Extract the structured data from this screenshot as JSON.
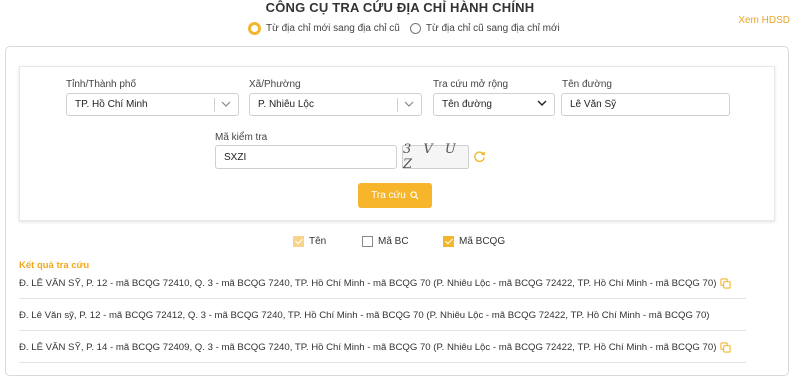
{
  "header": {
    "title": "CÔNG CỤ TRA CỨU ĐỊA CHỈ HÀNH CHÍNH",
    "help_link": "Xem HDSD"
  },
  "mode_options": [
    {
      "label": "Từ địa chỉ mới sang địa chỉ cũ",
      "selected": true
    },
    {
      "label": "Từ địa chỉ cũ sang địa chỉ mới",
      "selected": false
    }
  ],
  "form": {
    "province_label": "Tỉnh/Thành phố",
    "province_value": "TP. Hồ Chí Minh",
    "ward_label": "Xã/Phường",
    "ward_value": "P. Nhiêu Lộc",
    "extended_label": "Tra cứu mở rộng",
    "extended_value": "Tên đường",
    "street_label": "Tên đường",
    "street_value": "Lê Văn Sỹ",
    "captcha_label": "Mã kiểm tra",
    "captcha_input": "SXZI",
    "captcha_image_text": "3 V U Z",
    "search_button": "Tra cứu"
  },
  "display_options": [
    {
      "label": "Tên",
      "checked": true
    },
    {
      "label": "Mã BC",
      "checked": false
    },
    {
      "label": "Mã BCQG",
      "checked": true
    }
  ],
  "results": {
    "title": "Kết quả tra cứu",
    "rows": [
      "Đ. LÊ VĂN SỸ, P. 12 - mã BCQG 72410, Q. 3 - mã BCQG 7240, TP. Hồ Chí Minh - mã BCQG 70 (P. Nhiêu Lộc - mã BCQG 72422, TP. Hồ Chí Minh - mã BCQG 70)",
      "Đ. Lê Văn sỹ, P. 12 - mã BCQG 72412, Q. 3 - mã BCQG 7240, TP. Hồ Chí Minh - mã BCQG 70 (P. Nhiêu Lộc - mã BCQG 72422, TP. Hồ Chí Minh - mã BCQG 70)",
      "Đ. LÊ VĂN SỸ, P. 14 - mã BCQG 72409, Q. 3 - mã BCQG 7240, TP. Hồ Chí Minh - mã BCQG 70 (P. Nhiêu Lộc - mã BCQG 72422, TP. Hồ Chí Minh - mã BCQG 70)"
    ]
  },
  "colors": {
    "accent": "#f3b72e",
    "result_title": "#f0a81c"
  }
}
